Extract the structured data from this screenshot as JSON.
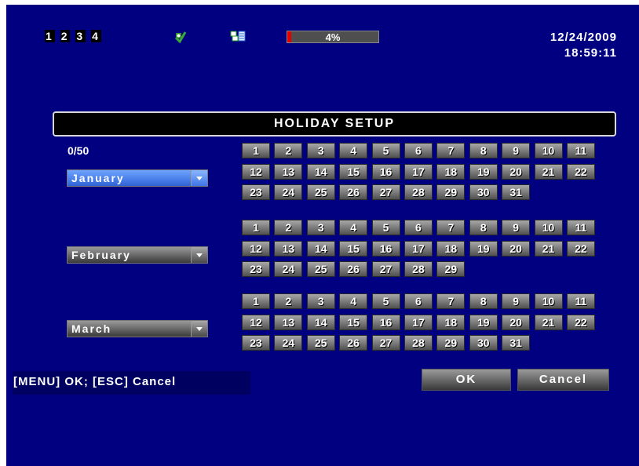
{
  "status": {
    "cameras": [
      "1",
      "2",
      "3",
      "4"
    ],
    "hdd_usage": "4%",
    "hdd_fraction": 0.04,
    "date": "12/24/2009",
    "time": "18:59:11"
  },
  "dialog": {
    "title": "HOLIDAY SETUP",
    "count": "0/50",
    "months": [
      {
        "name": "January",
        "selected": true,
        "days": [
          "1",
          "2",
          "3",
          "4",
          "5",
          "6",
          "7",
          "8",
          "9",
          "10",
          "11",
          "12",
          "13",
          "14",
          "15",
          "16",
          "17",
          "18",
          "19",
          "20",
          "21",
          "22",
          "23",
          "24",
          "25",
          "26",
          "27",
          "28",
          "29",
          "30",
          "31"
        ]
      },
      {
        "name": "February",
        "selected": false,
        "days": [
          "1",
          "2",
          "3",
          "4",
          "5",
          "6",
          "7",
          "8",
          "9",
          "10",
          "11",
          "12",
          "13",
          "14",
          "15",
          "16",
          "17",
          "18",
          "19",
          "20",
          "21",
          "22",
          "23",
          "24",
          "25",
          "26",
          "27",
          "28",
          "29"
        ]
      },
      {
        "name": "March",
        "selected": false,
        "days": [
          "1",
          "2",
          "3",
          "4",
          "5",
          "6",
          "7",
          "8",
          "9",
          "10",
          "11",
          "12",
          "13",
          "14",
          "15",
          "16",
          "17",
          "18",
          "19",
          "20",
          "21",
          "22",
          "23",
          "24",
          "25",
          "26",
          "27",
          "28",
          "29",
          "30",
          "31"
        ]
      }
    ],
    "hint": "[MENU] OK; [ESC] Cancel",
    "ok_label": "OK",
    "cancel_label": "Cancel"
  },
  "icons": [
    "record-icon",
    "network-icon"
  ],
  "colors": {
    "background": "#000080",
    "hdd_fill": "#e00000",
    "selected": "#3f74e6"
  }
}
